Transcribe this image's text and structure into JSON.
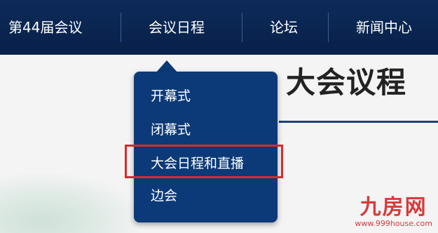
{
  "nav": {
    "items": [
      {
        "label": "第44届会议"
      },
      {
        "label": "会议日程"
      },
      {
        "label": "论坛"
      },
      {
        "label": "新闻中心"
      }
    ]
  },
  "page": {
    "title": "大会议程"
  },
  "dropdown": {
    "items": [
      {
        "label": "开幕式"
      },
      {
        "label": "闭幕式"
      },
      {
        "label": "大会日程和直播",
        "highlighted": true
      },
      {
        "label": "边会"
      }
    ],
    "highlight_color": "#e02727",
    "background_color": "#0c3a78"
  },
  "colors": {
    "nav_bg": "#0a2550",
    "accent": "#1c3f77"
  },
  "watermark": {
    "logo": "九房网",
    "url": "www.999house.com"
  }
}
